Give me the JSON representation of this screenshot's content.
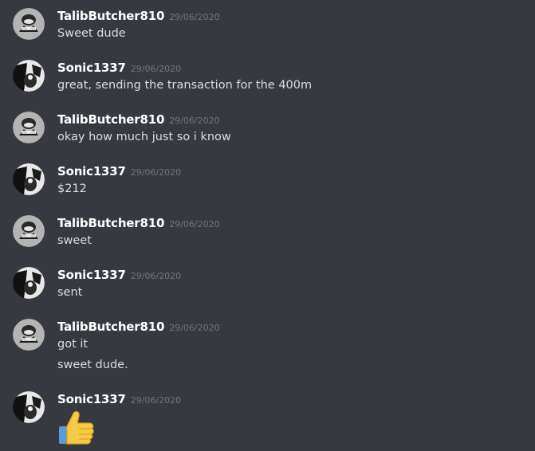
{
  "messages": [
    {
      "author": "TalibButcher810",
      "timestamp": "29/06/2020",
      "avatar": "talib-avatar",
      "lines": [
        "Sweet dude"
      ]
    },
    {
      "author": "Sonic1337",
      "timestamp": "29/06/2020",
      "avatar": "sonic-avatar",
      "lines": [
        "great, sending the transaction for the 400m"
      ]
    },
    {
      "author": "TalibButcher810",
      "timestamp": "29/06/2020",
      "avatar": "talib-avatar",
      "lines": [
        "okay how much just so i know"
      ]
    },
    {
      "author": "Sonic1337",
      "timestamp": "29/06/2020",
      "avatar": "sonic-avatar",
      "lines": [
        "$212"
      ]
    },
    {
      "author": "TalibButcher810",
      "timestamp": "29/06/2020",
      "avatar": "talib-avatar",
      "lines": [
        "sweet"
      ]
    },
    {
      "author": "Sonic1337",
      "timestamp": "29/06/2020",
      "avatar": "sonic-avatar",
      "lines": [
        "sent"
      ]
    },
    {
      "author": "TalibButcher810",
      "timestamp": "29/06/2020",
      "avatar": "talib-avatar",
      "lines": [
        "got it",
        "sweet dude."
      ]
    },
    {
      "author": "Sonic1337",
      "timestamp": "29/06/2020",
      "avatar": "sonic-avatar",
      "lines": [],
      "emoji": "thumbs-up-icon"
    }
  ],
  "colors": {
    "background": "#36393f",
    "username": "#ffffff",
    "timestamp": "#72767d",
    "message_text": "#dcddde",
    "emoji": "#f7c948"
  }
}
